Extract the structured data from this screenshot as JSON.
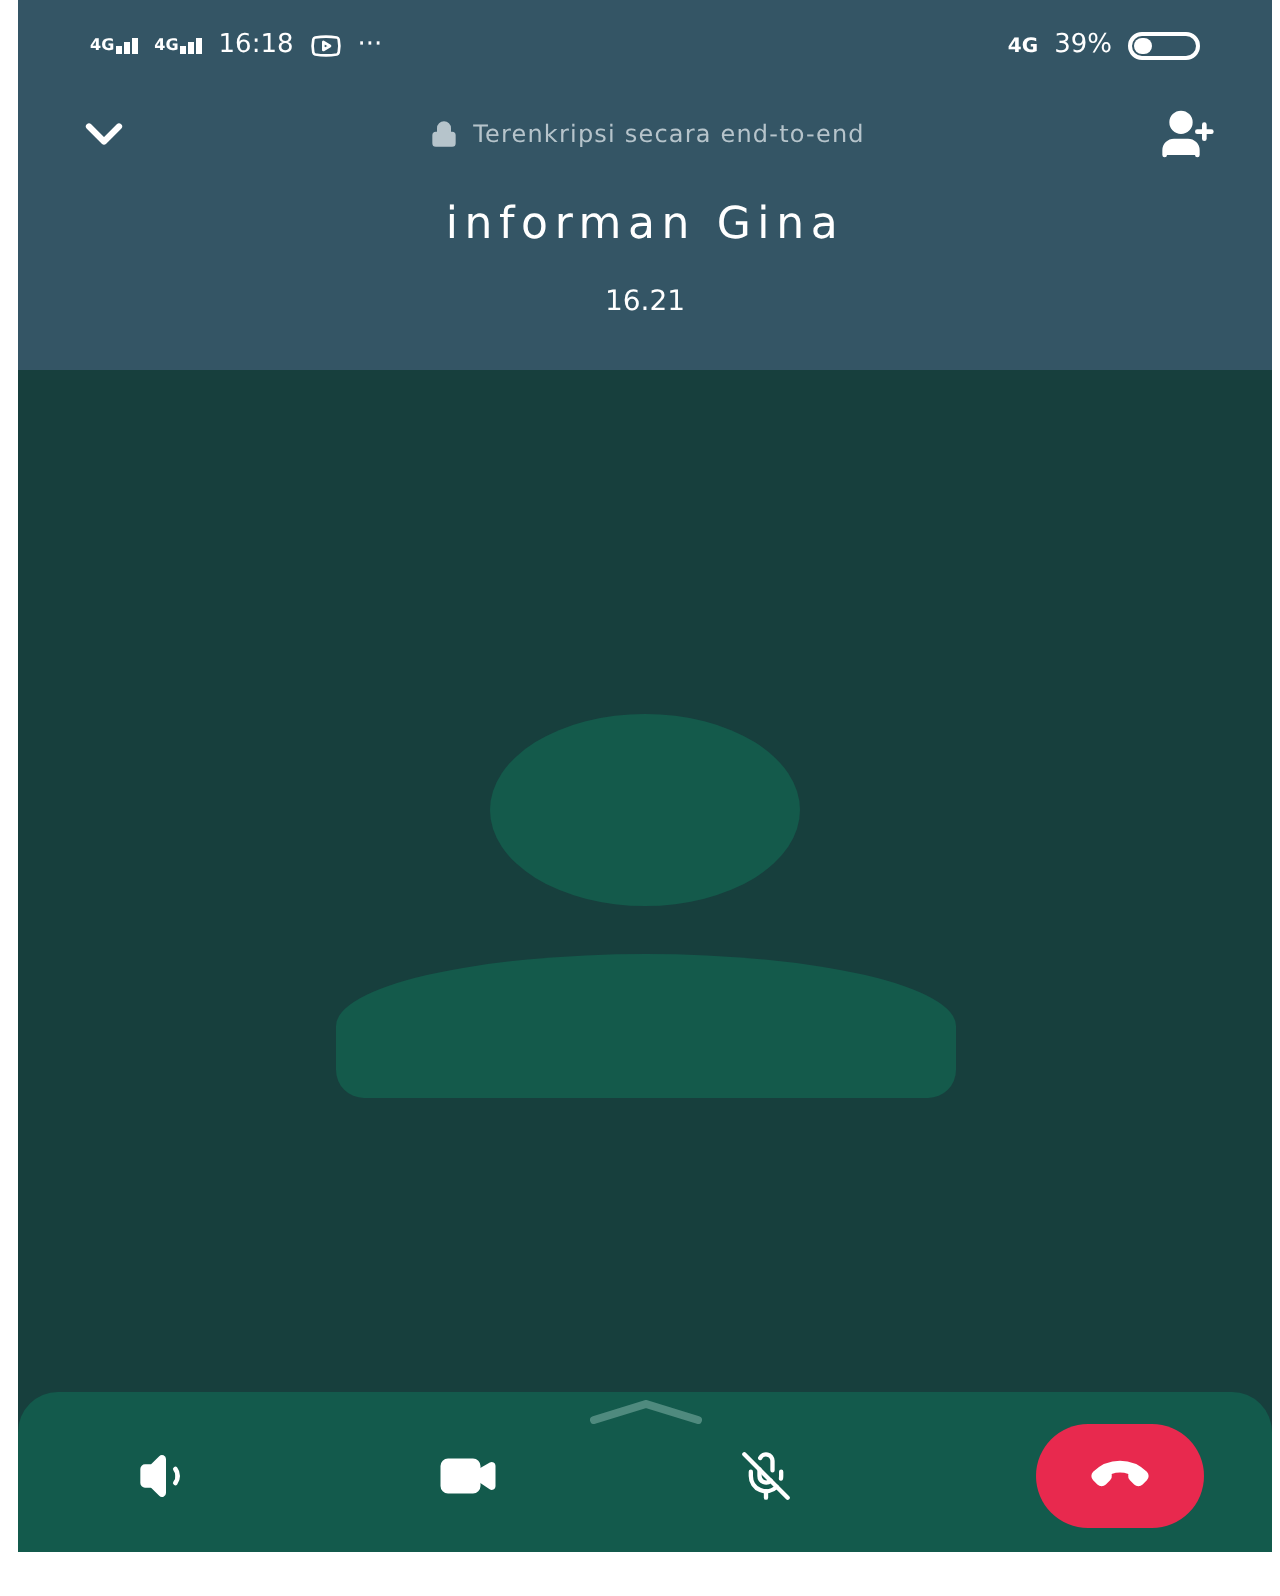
{
  "status_bar": {
    "sim_1": "4G",
    "sim_2": "4G",
    "time": "16:18",
    "more": "···",
    "network": "4G",
    "battery": "39%",
    "battery_icon": {
      "level": 0.3
    }
  },
  "header": {
    "encryption": "Terenkripsi secara end-to-end",
    "contact_name": "informan Gina",
    "duration": "16.21"
  },
  "controls": {
    "microphone_muted": true
  }
}
